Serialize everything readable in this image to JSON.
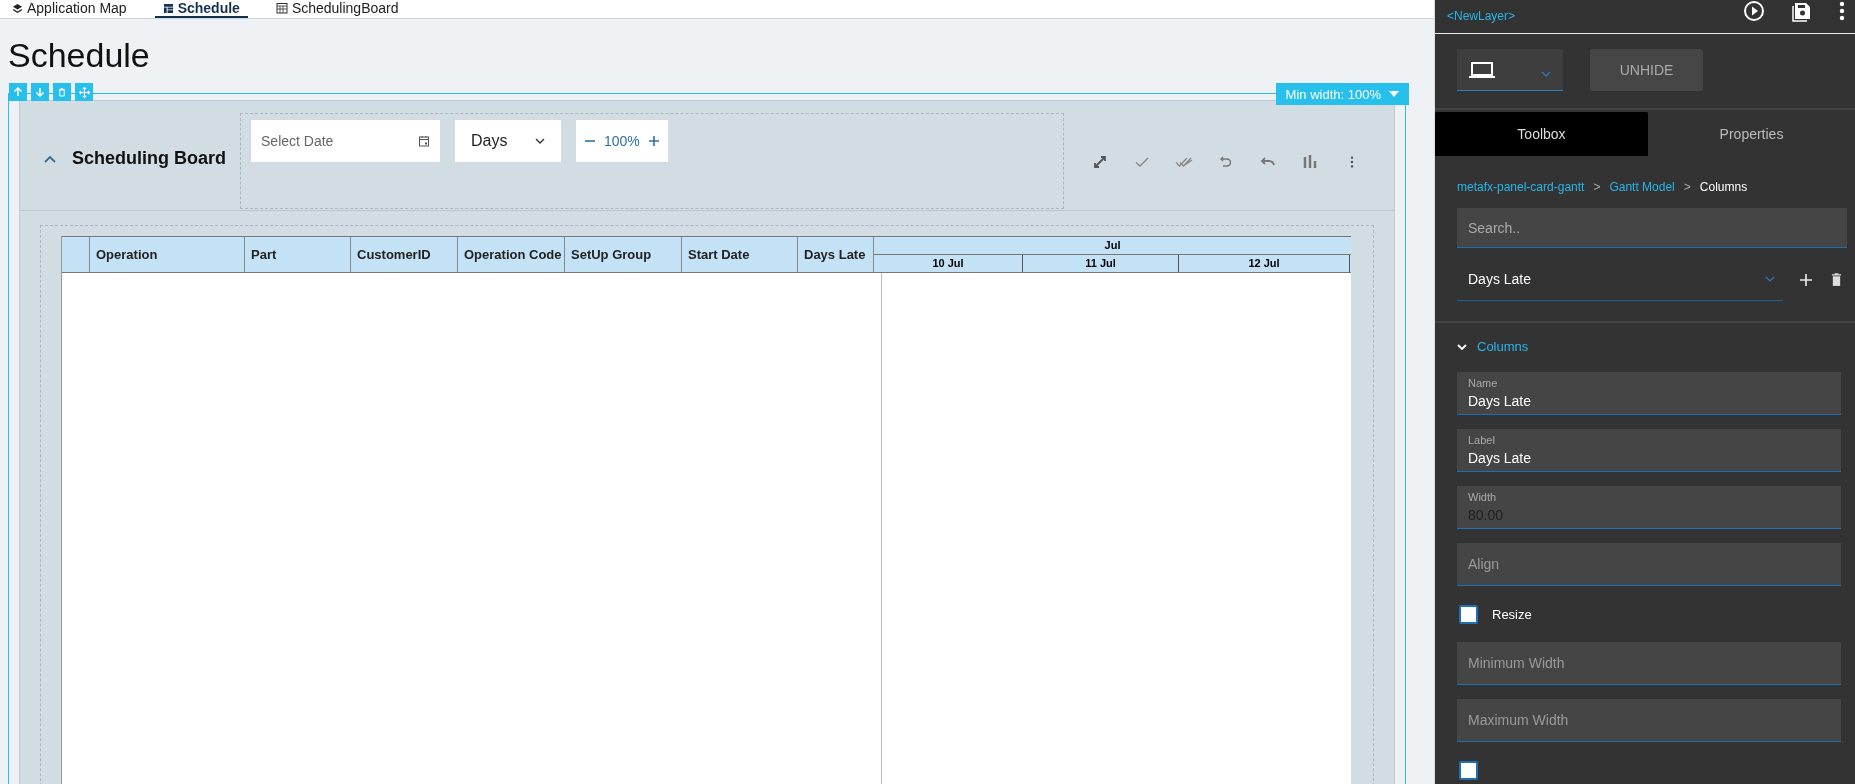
{
  "tabs": [
    {
      "label": "Application Map",
      "selected": false,
      "kind": "layers"
    },
    {
      "label": "Schedule",
      "selected": true,
      "kind": "table"
    },
    {
      "label": "SchedulingBoard",
      "selected": false,
      "kind": "grid"
    }
  ],
  "page_title": "Schedule",
  "frame": {
    "min_width_badge": "Min width: 100%"
  },
  "card": {
    "title": "Scheduling Board",
    "expanded": true,
    "date_field": {
      "placeholder": "Select Date"
    },
    "view_select": {
      "value": "Days"
    },
    "zoom": {
      "value": "100%"
    }
  },
  "grid": {
    "columns": [
      "Operation",
      "Part",
      "CustomerID",
      "Operation Code",
      "SetUp Group",
      "Start Date",
      "Days Late"
    ],
    "timeline": {
      "month": "Jul",
      "days": [
        "10 Jul",
        "11 Jul",
        "12 Jul"
      ]
    }
  },
  "panel": {
    "layer": "<NewLayer>",
    "unhide_button": "UNHIDE",
    "tabs": [
      {
        "label": "Toolbox",
        "selected": true
      },
      {
        "label": "Properties",
        "selected": false
      }
    ],
    "breadcrumb": [
      {
        "label": "metafx-panel-card-gantt",
        "current": false
      },
      {
        "label": "Gantt Model",
        "current": false,
        "separator": ">"
      },
      {
        "label": "Columns",
        "current": true,
        "separator": ">"
      }
    ],
    "search": {
      "placeholder": "Search.."
    },
    "column_select": {
      "value": "Days Late"
    },
    "section": {
      "title": "Columns",
      "expanded": true
    },
    "fields": [
      {
        "kind": "text",
        "label": "Name",
        "value": "Days Late",
        "disabled": false
      },
      {
        "kind": "text",
        "label": "Label",
        "value": "Days Late",
        "disabled": false
      },
      {
        "kind": "text",
        "label": "Width",
        "value": "80.00",
        "disabled": true
      },
      {
        "kind": "text",
        "placeholder": "Align"
      },
      {
        "kind": "checkbox",
        "label": "Resize",
        "checked": false
      },
      {
        "kind": "text",
        "placeholder": "Minimum Width"
      },
      {
        "kind": "text",
        "placeholder": "Maximum Width"
      },
      {
        "kind": "checkbox",
        "checked": false
      }
    ]
  }
}
